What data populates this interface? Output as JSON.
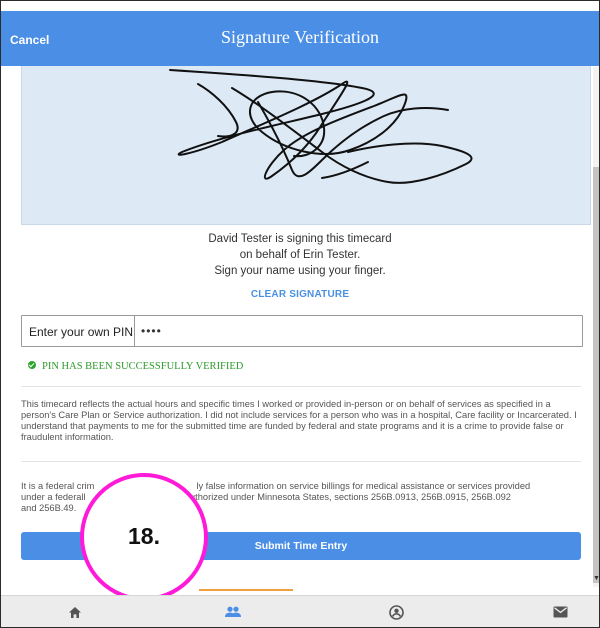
{
  "header": {
    "cancel_label": "Cancel",
    "title": "Signature Verification"
  },
  "signature": {
    "signer_line": "David Tester is signing this timecard",
    "behalf_line": "on behalf of  Erin Tester.",
    "instruction": "Sign your name using your finger.",
    "clear_label": "CLEAR SIGNATURE"
  },
  "pin": {
    "label": "Enter your own PIN",
    "value": "••••"
  },
  "verification": {
    "status": "PIN HAS BEEN SUCCESSFULLY VERIFIED",
    "status_color": "#2c9a2c"
  },
  "legal": {
    "timecard_text": "This timecard reflects the actual hours and specific times I worked or provided in-person or on behalf of services as specified in a person's Care Plan or Service authorization. I did not include services for a person who was in a hospital, Care facility or Incarcerated. I understand that payments to me for the submitted time are funded by federal and state programs and it is a crime to provide false or fraudulent information.",
    "crime_text_a": "It is a federal crim",
    "crime_text_b": "ly false information on service billings for medical assistance or services provided",
    "crime_text_c": "under a federall",
    "crime_text_d": "s authorized under Minnesota States, sections 256B.0913, 256B.0915, 256B.092",
    "crime_text_e": "and 256B.49."
  },
  "actions": {
    "submit_label": "Submit Time Entry"
  },
  "annotation": {
    "step_label": "18.",
    "color": "#ff1ad9"
  },
  "nav": {
    "items": [
      "home-icon",
      "people-icon",
      "account-icon",
      "mail-icon"
    ],
    "active_index": 1,
    "active_color": "#4a8ee6"
  },
  "colors": {
    "brand": "#4a8ee6",
    "signature_pad": "#ddeaf6"
  }
}
